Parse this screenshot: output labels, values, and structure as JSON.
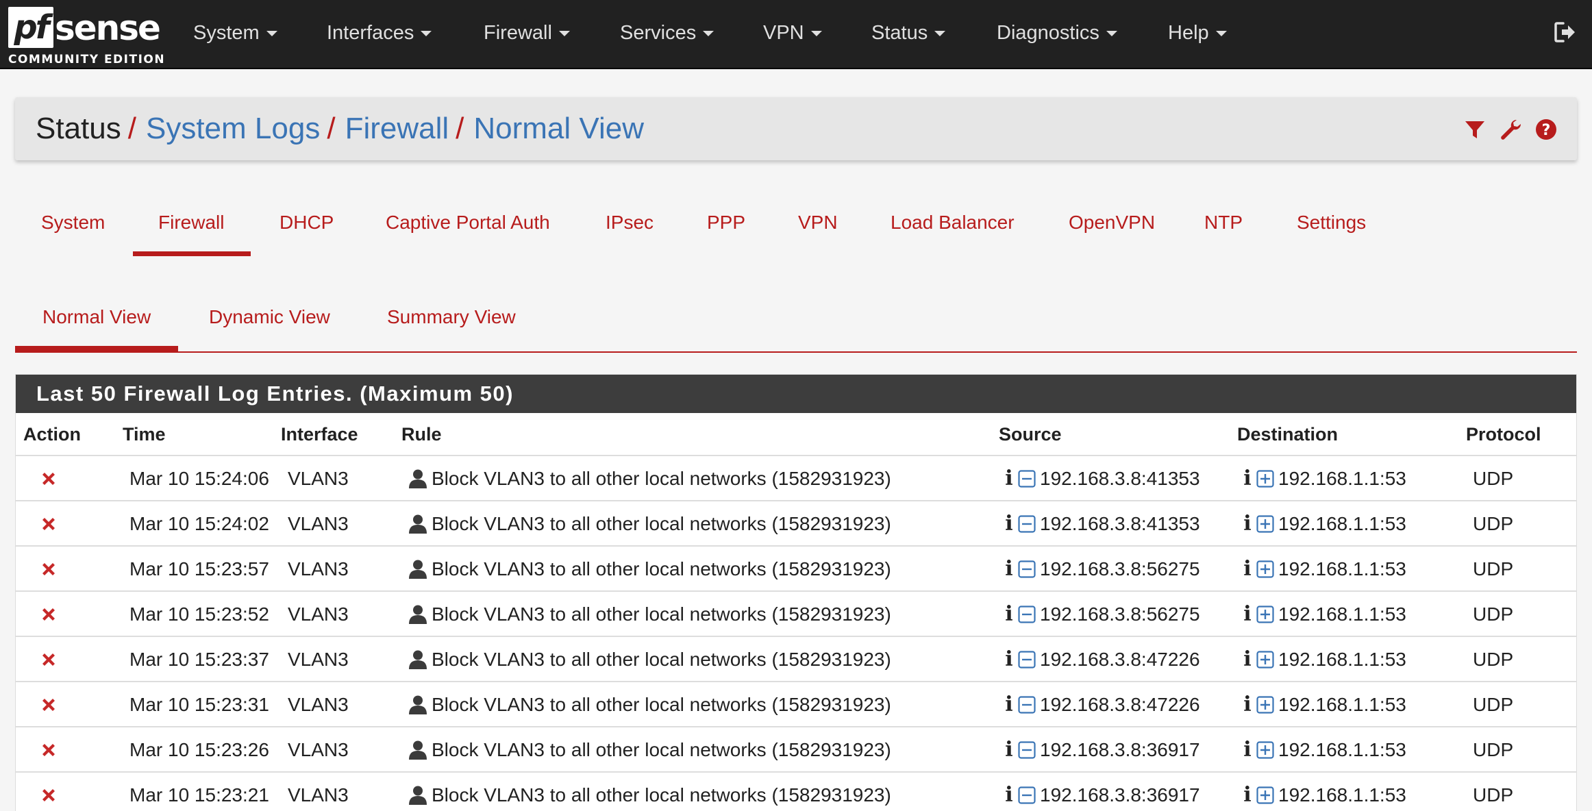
{
  "brand": {
    "logo_pf": "pf",
    "logo_sense": "sense",
    "subtitle": "COMMUNITY EDITION"
  },
  "nav": {
    "items": [
      "System",
      "Interfaces",
      "Firewall",
      "Services",
      "VPN",
      "Status",
      "Diagnostics",
      "Help"
    ],
    "logout_icon": "sign-out-icon"
  },
  "breadcrumb": {
    "items": [
      "Status",
      "System Logs",
      "Firewall",
      "Normal View"
    ],
    "separator": "/",
    "actions": [
      "filter-icon",
      "wrench-icon",
      "question-circle-icon"
    ]
  },
  "tabs": {
    "items": [
      "System",
      "Firewall",
      "DHCP",
      "Captive Portal Auth",
      "IPsec",
      "PPP",
      "VPN",
      "Load Balancer",
      "OpenVPN",
      "NTP",
      "Settings"
    ],
    "active": "Firewall"
  },
  "subtabs": {
    "items": [
      "Normal View",
      "Dynamic View",
      "Summary View"
    ],
    "active": "Normal View"
  },
  "log_panel": {
    "title": "Last 50 Firewall Log Entries. (Maximum 50)",
    "columns": [
      "Action",
      "Time",
      "Interface",
      "Rule",
      "Source",
      "Destination",
      "Protocol"
    ],
    "rows": [
      {
        "time": "Mar 10 15:24:06",
        "interface": "VLAN3",
        "rule": "Block VLAN3 to all other local networks (1582931923)",
        "source": "192.168.3.8:41353",
        "destination": "192.168.1.1:53",
        "protocol": "UDP"
      },
      {
        "time": "Mar 10 15:24:02",
        "interface": "VLAN3",
        "rule": "Block VLAN3 to all other local networks (1582931923)",
        "source": "192.168.3.8:41353",
        "destination": "192.168.1.1:53",
        "protocol": "UDP"
      },
      {
        "time": "Mar 10 15:23:57",
        "interface": "VLAN3",
        "rule": "Block VLAN3 to all other local networks (1582931923)",
        "source": "192.168.3.8:56275",
        "destination": "192.168.1.1:53",
        "protocol": "UDP"
      },
      {
        "time": "Mar 10 15:23:52",
        "interface": "VLAN3",
        "rule": "Block VLAN3 to all other local networks (1582931923)",
        "source": "192.168.3.8:56275",
        "destination": "192.168.1.1:53",
        "protocol": "UDP"
      },
      {
        "time": "Mar 10 15:23:37",
        "interface": "VLAN3",
        "rule": "Block VLAN3 to all other local networks (1582931923)",
        "source": "192.168.3.8:47226",
        "destination": "192.168.1.1:53",
        "protocol": "UDP"
      },
      {
        "time": "Mar 10 15:23:31",
        "interface": "VLAN3",
        "rule": "Block VLAN3 to all other local networks (1582931923)",
        "source": "192.168.3.8:47226",
        "destination": "192.168.1.1:53",
        "protocol": "UDP"
      },
      {
        "time": "Mar 10 15:23:26",
        "interface": "VLAN3",
        "rule": "Block VLAN3 to all other local networks (1582931923)",
        "source": "192.168.3.8:36917",
        "destination": "192.168.1.1:53",
        "protocol": "UDP"
      },
      {
        "time": "Mar 10 15:23:21",
        "interface": "VLAN3",
        "rule": "Block VLAN3 to all other local networks (1582931923)",
        "source": "192.168.3.8:36917",
        "destination": "192.168.1.1:53",
        "protocol": "UDP"
      }
    ]
  },
  "colors": {
    "accent": "#b71c1c",
    "link": "#3a74b5",
    "navbar": "#212121",
    "panel_heading": "#3d3d3d"
  }
}
